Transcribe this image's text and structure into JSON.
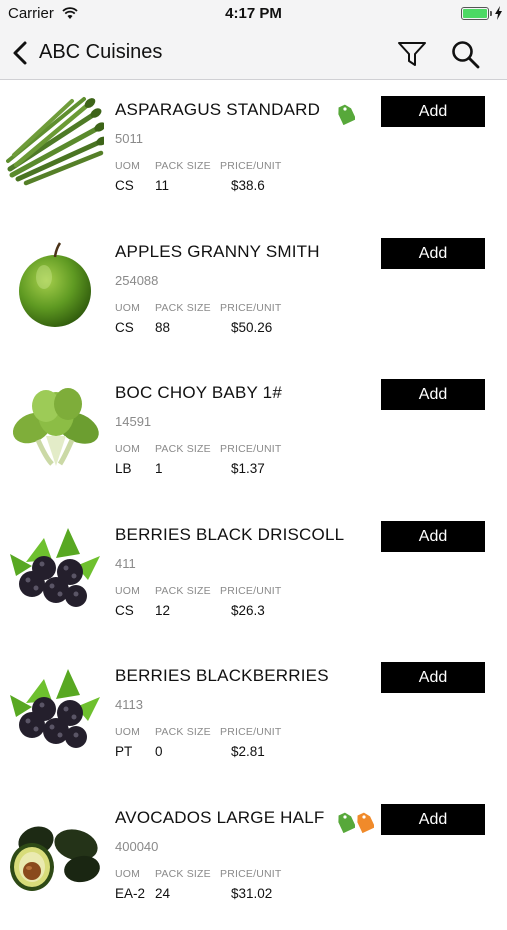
{
  "status_bar": {
    "carrier": "Carrier",
    "time": "4:17 PM"
  },
  "nav": {
    "back_icon": "chevron-left-icon",
    "title": "ABC Cuisines",
    "filter_icon": "filter-icon",
    "search_icon": "search-icon"
  },
  "columns": {
    "uom": "UOM",
    "pack_size": "PACK SIZE",
    "price_unit": "PRICE/UNIT"
  },
  "add_label": "Add",
  "colors": {
    "tag_green": "#57a83a",
    "tag_orange": "#f08a2a",
    "battery": "#4cd964"
  },
  "products": [
    {
      "name": "ASPARAGUS STANDARD",
      "code": "5011",
      "uom": "CS",
      "pack_size": "11",
      "price": "$38.6",
      "image": "asparagus",
      "tags": [
        "green"
      ]
    },
    {
      "name": "APPLES GRANNY SMITH",
      "code": "254088",
      "uom": "CS",
      "pack_size": "88",
      "price": "$50.26",
      "image": "green-apple",
      "tags": []
    },
    {
      "name": "BOC CHOY BABY 1#",
      "code": "14591",
      "uom": "LB",
      "pack_size": "1",
      "price": "$1.37",
      "image": "bok-choy",
      "tags": []
    },
    {
      "name": "BERRIES BLACK DRISCOLL",
      "code": "411",
      "uom": "CS",
      "pack_size": "12",
      "price": "$26.3",
      "image": "blackberries",
      "tags": []
    },
    {
      "name": "BERRIES BLACKBERRIES",
      "code": "4113",
      "uom": "PT",
      "pack_size": "0",
      "price": "$2.81",
      "image": "blackberries",
      "tags": []
    },
    {
      "name": "AVOCADOS LARGE HALF",
      "code": "400040",
      "uom": "EA-2",
      "pack_size": "24",
      "price": "$31.02",
      "image": "avocado",
      "tags": [
        "green",
        "orange"
      ]
    }
  ]
}
